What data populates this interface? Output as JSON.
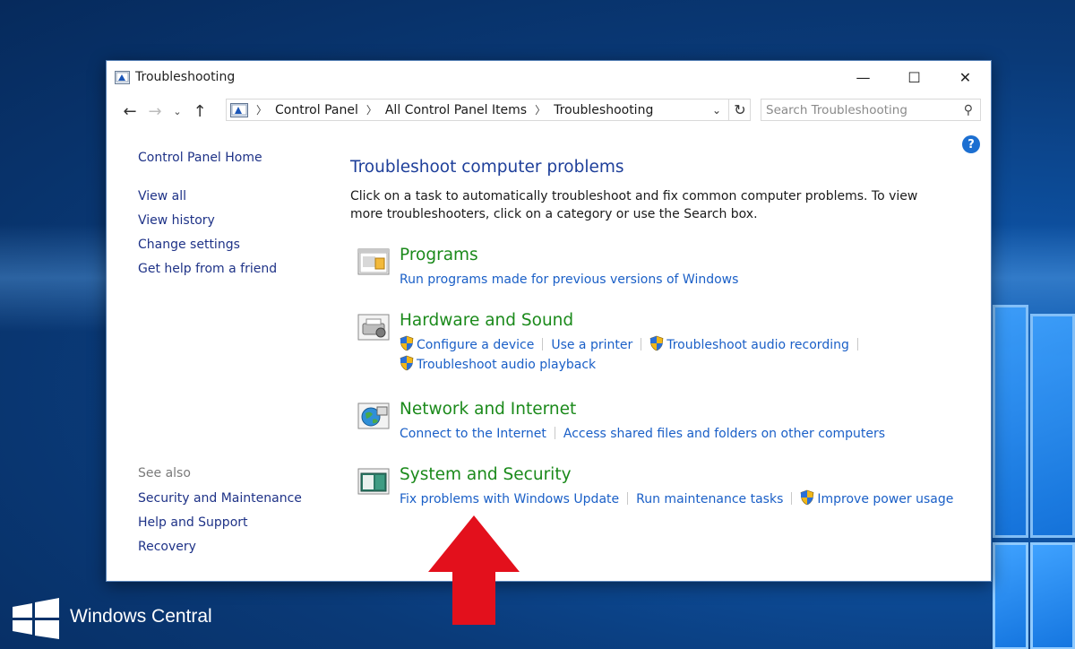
{
  "window": {
    "title": "Troubleshooting"
  },
  "titlebar_buttons": {
    "minimize": "—",
    "maximize": "☐",
    "close": "✕"
  },
  "navbar": {
    "breadcrumb": [
      "Control Panel",
      "All Control Panel Items",
      "Troubleshooting"
    ],
    "search_placeholder": "Search Troubleshooting"
  },
  "sidebar": {
    "home": "Control Panel Home",
    "links": [
      "View all",
      "View history",
      "Change settings",
      "Get help from a friend"
    ],
    "see_also_label": "See also",
    "see_also": [
      "Security and Maintenance",
      "Help and Support",
      "Recovery"
    ]
  },
  "main": {
    "heading": "Troubleshoot computer problems",
    "description": "Click on a task to automatically troubleshoot and fix common computer problems. To view more troubleshooters, click on a category or use the Search box.",
    "categories": [
      {
        "name": "Programs",
        "icon": "programs-icon",
        "links": [
          "Run programs made for previous versions of Windows"
        ]
      },
      {
        "name": "Hardware and Sound",
        "icon": "hardware-sound-icon",
        "links": [
          "Configure a device",
          "Use a printer",
          "Troubleshoot audio recording",
          "Troubleshoot audio playback"
        ]
      },
      {
        "name": "Network and Internet",
        "icon": "network-internet-icon",
        "links": [
          "Connect to the Internet",
          "Access shared files and folders on other computers"
        ]
      },
      {
        "name": "System and Security",
        "icon": "system-security-icon",
        "links": [
          "Fix problems with Windows Update",
          "Run maintenance tasks",
          "Improve power usage"
        ]
      }
    ]
  },
  "watermark": {
    "text": "Windows Central"
  },
  "colors": {
    "link": "#1a5fc7",
    "category": "#1b8a1b",
    "heading": "#1e3f9a",
    "arrow": "#e3101c"
  }
}
